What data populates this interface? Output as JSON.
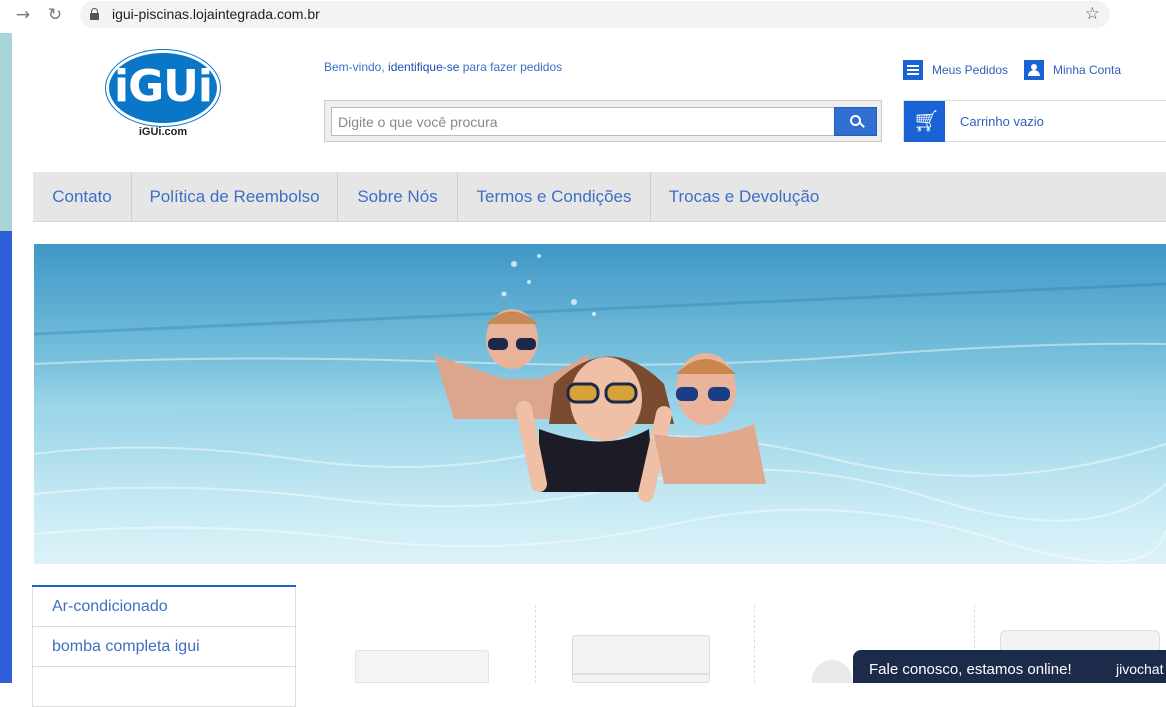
{
  "browser": {
    "url": "igui-piscinas.lojaintegrada.com.br"
  },
  "header": {
    "logo_text": "iGUi",
    "logo_sub": "iGUi.com",
    "welcome_prefix": "Bem-vindo, ",
    "welcome_link": "identifique-se",
    "welcome_suffix": " para fazer pedidos",
    "orders_label": "Meus Pedidos",
    "account_label": "Minha Conta",
    "cart_label": "Carrinho vazio",
    "search_placeholder": "Digite o que você procura"
  },
  "menu": {
    "items": [
      {
        "label": "Contato"
      },
      {
        "label": "Política de Reembolso"
      },
      {
        "label": "Sobre Nós"
      },
      {
        "label": "Termos e Condições"
      },
      {
        "label": "Trocas e Devolução"
      }
    ]
  },
  "categories": [
    {
      "label": "Ar-condicionado"
    },
    {
      "label": "bomba completa igui"
    },
    {
      "label": ""
    }
  ],
  "chat": {
    "text": "Fale conosco, estamos online!",
    "brand": "jivochat"
  },
  "colors": {
    "accent": "#1a63d4",
    "link": "#3d6fc4",
    "chat_bg": "#1d2b4a"
  },
  "icons": [
    "back-arrow-icon",
    "reload-icon",
    "lock-icon",
    "star-icon",
    "search-icon",
    "list-icon",
    "user-icon",
    "cart-icon"
  ]
}
